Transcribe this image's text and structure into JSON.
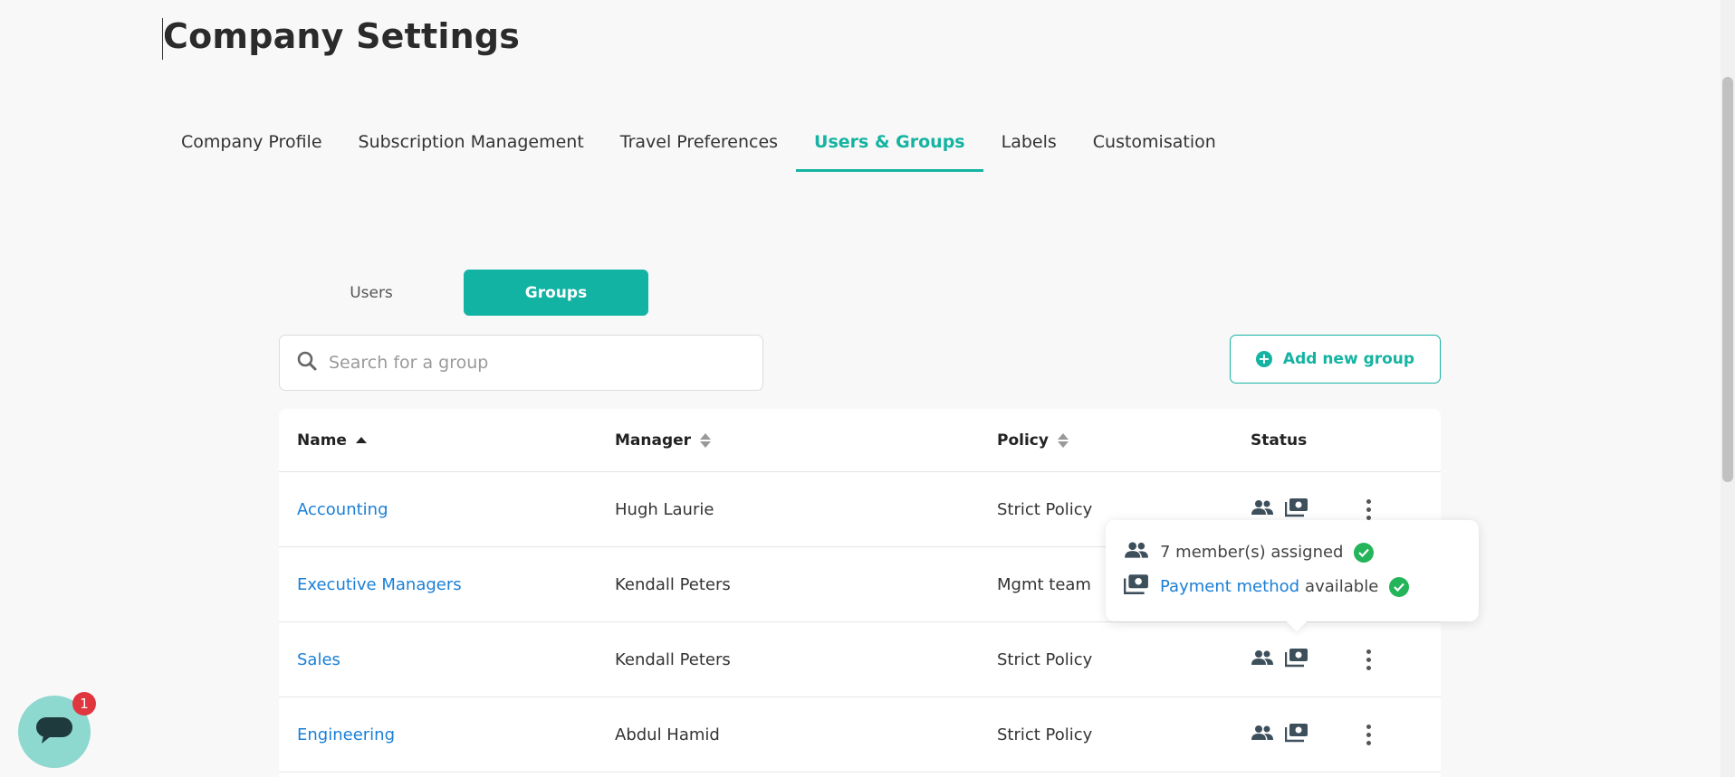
{
  "page": {
    "title": "Company Settings"
  },
  "tabs": [
    {
      "label": "Company Profile"
    },
    {
      "label": "Subscription Management"
    },
    {
      "label": "Travel Preferences"
    },
    {
      "label": "Users & Groups",
      "active": true
    },
    {
      "label": "Labels"
    },
    {
      "label": "Customisation"
    }
  ],
  "segment": {
    "users_label": "Users",
    "groups_label": "Groups",
    "active": "Groups"
  },
  "search": {
    "placeholder": "Search for a group",
    "value": ""
  },
  "add_button": {
    "label": "Add new group"
  },
  "table": {
    "headers": {
      "name": "Name",
      "manager": "Manager",
      "policy": "Policy",
      "status": "Status"
    },
    "rows": [
      {
        "name": "Accounting",
        "manager": "Hugh Laurie",
        "policy": "Strict Policy"
      },
      {
        "name": "Executive Managers",
        "manager": "Kendall Peters",
        "policy": "Mgmt team"
      },
      {
        "name": "Sales",
        "manager": "Kendall Peters",
        "policy": "Strict Policy"
      },
      {
        "name": "Engineering",
        "manager": "Abdul Hamid",
        "policy": "Strict Policy"
      }
    ]
  },
  "popover": {
    "members_text": "7 member(s) assigned",
    "payment_link": "Payment method",
    "payment_suffix": "available"
  },
  "chat": {
    "badge": "1"
  },
  "colors": {
    "accent": "#14b3a2",
    "link": "#1a7fd6",
    "success": "#24b45a",
    "badge": "#e0363f"
  },
  "icons": [
    "search-icon",
    "plus-circle-icon",
    "sort-icon",
    "members-icon",
    "payment-icon",
    "more-vertical-icon",
    "check-circle-icon",
    "chat-icon"
  ]
}
